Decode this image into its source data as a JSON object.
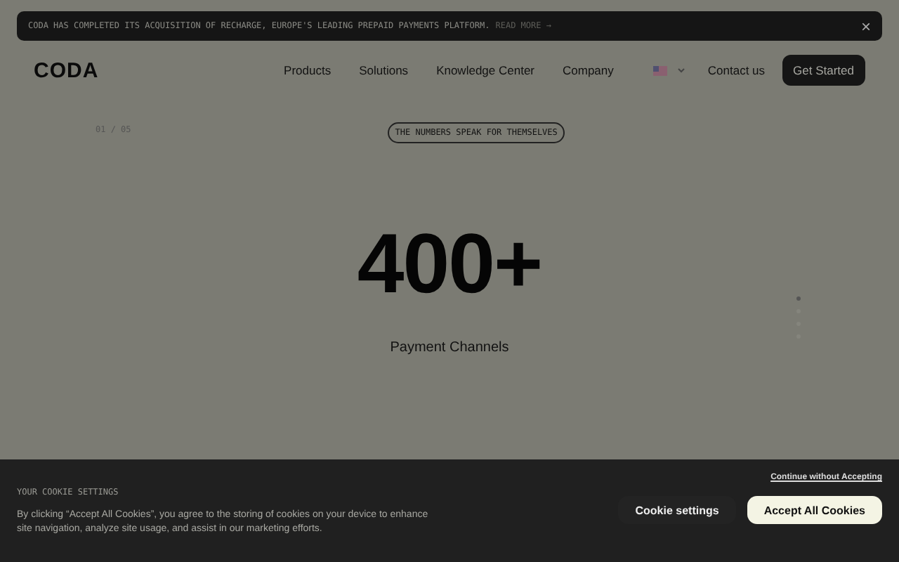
{
  "banner": {
    "text": "CODA HAS COMPLETED ITS ACQUISITION OF RECHARGE, EUROPE'S LEADING PREPAID PAYMENTS PLATFORM.",
    "link": "READ MORE →",
    "close": "×"
  },
  "nav": {
    "logo": "CODA",
    "items": [
      "Products",
      "Solutions",
      "Knowledge Center",
      "Company"
    ],
    "contact": "Contact us",
    "cta": "Get Started"
  },
  "hero": {
    "counter": "01 / 05",
    "tag": "THE NUMBERS SPEAK FOR THEMSELVES",
    "value": "400+",
    "caption": "Payment Channels"
  },
  "pager": [
    {
      "selected": true
    },
    {
      "selected": false
    },
    {
      "selected": false
    },
    {
      "selected": false
    }
  ],
  "cookie": {
    "title": "YOUR COOKIE SETTINGS",
    "text": "By clicking “Accept All Cookies”, you agree to the storing of cookies on your device to enhance site navigation, analyze site usage, and assist in our marketing efforts.",
    "continue": "Continue without Accepting",
    "settings": "Cookie settings",
    "accept": "Accept All Cookies"
  }
}
